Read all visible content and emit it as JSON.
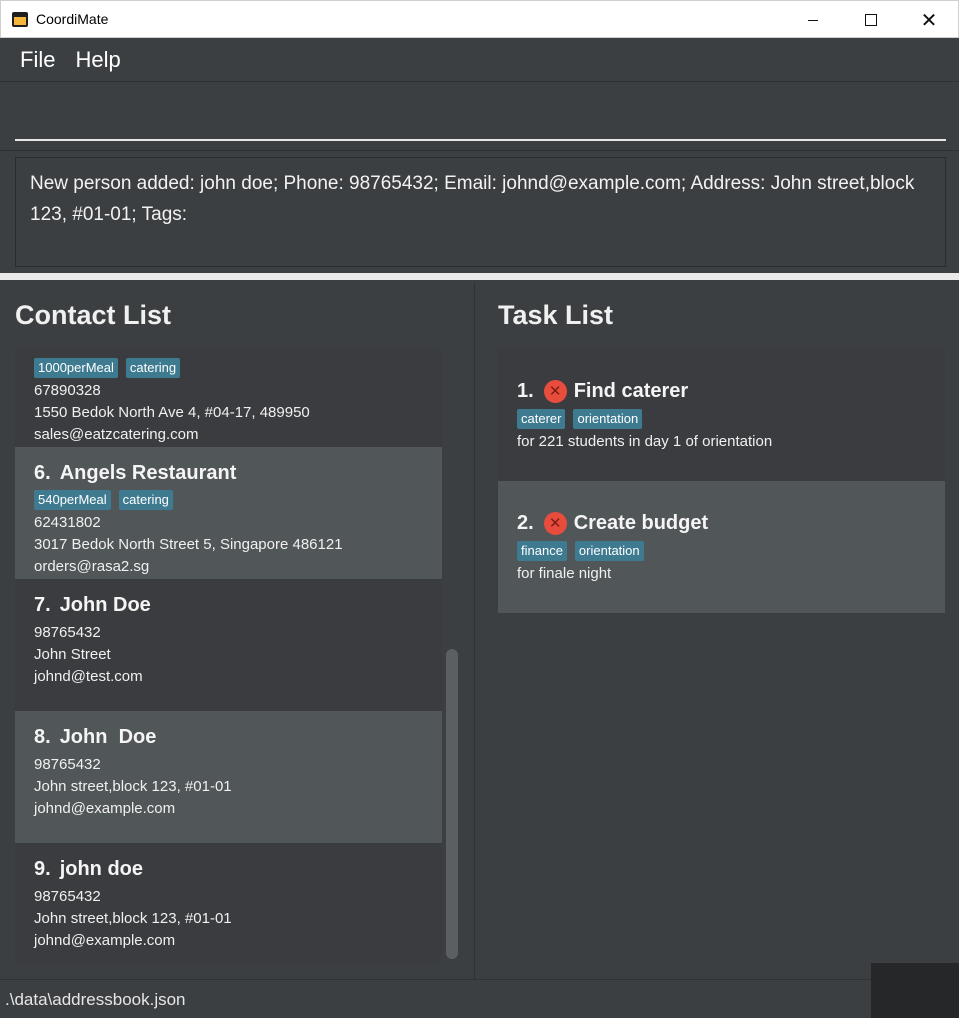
{
  "window": {
    "title": "CoordiMate",
    "minimize_icon": "minimize-icon",
    "maximize_icon": "maximize-icon",
    "close_icon": "close-icon",
    "close_glyph": "✕"
  },
  "menu": {
    "items": [
      {
        "label": "File"
      },
      {
        "label": "Help"
      }
    ]
  },
  "command": {
    "value": "",
    "placeholder": ""
  },
  "result": {
    "text": "New person added: john doe; Phone: 98765432; Email: johnd@example.com; Address: John street,block 123, #01-01; Tags:"
  },
  "contact_list": {
    "title": "Contact List",
    "contacts": [
      {
        "index": "",
        "name": "",
        "tags": [
          "1000perMeal",
          "catering"
        ],
        "phone": "67890328",
        "address": "1550 Bedok North Ave 4, #04-17, 489950",
        "email": "sales@eatzcatering.com"
      },
      {
        "index": "6.",
        "name": "Angels Restaurant",
        "tags": [
          "540perMeal",
          "catering"
        ],
        "phone": "62431802",
        "address": "3017 Bedok North Street 5, Singapore 486121",
        "email": "orders@rasa2.sg"
      },
      {
        "index": "7.",
        "name": "John Doe",
        "tags": [],
        "phone": "98765432",
        "address": "John Street",
        "email": "johnd@test.com"
      },
      {
        "index": "8.",
        "name": "John  Doe",
        "tags": [],
        "phone": "98765432",
        "address": "John street,block 123, #01-01",
        "email": "johnd@example.com"
      },
      {
        "index": "9.",
        "name": "john doe",
        "tags": [],
        "phone": "98765432",
        "address": "John street,block 123, #01-01",
        "email": "johnd@example.com"
      }
    ]
  },
  "task_list": {
    "title": "Task List",
    "tasks": [
      {
        "index": "1.",
        "status_icon": "not-done-icon",
        "status_glyph": "✕",
        "title": "Find caterer",
        "tags": [
          "caterer",
          "orientation"
        ],
        "note": "for 221 students in day 1 of orientation"
      },
      {
        "index": "2.",
        "status_icon": "not-done-icon",
        "status_glyph": "✕",
        "title": "Create budget",
        "tags": [
          "finance",
          "orientation"
        ],
        "note": "for finale night"
      }
    ]
  },
  "status_bar": {
    "path": ".\\data\\addressbook.json"
  },
  "colors": {
    "background": "#3c3f41",
    "card_alt": "#515658",
    "tag": "#3e7b91",
    "status_not_done": "#e84c3d"
  }
}
